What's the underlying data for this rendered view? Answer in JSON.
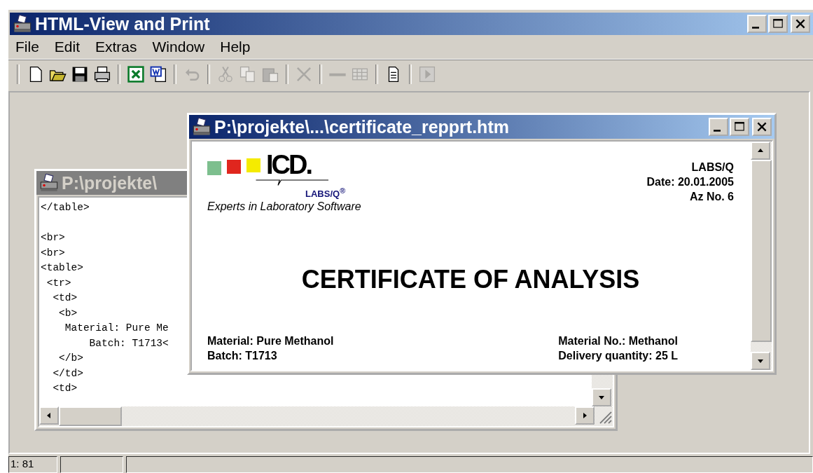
{
  "window": {
    "title": "HTML-View and Print"
  },
  "menu": [
    {
      "label": "File"
    },
    {
      "label": "Edit"
    },
    {
      "label": "Extras"
    },
    {
      "label": "Window"
    },
    {
      "label": "Help"
    }
  ],
  "toolbar": [
    [
      {
        "kind": "new",
        "disabled": false
      },
      {
        "kind": "open",
        "disabled": false
      },
      {
        "kind": "save",
        "disabled": false
      },
      {
        "kind": "print",
        "disabled": false
      }
    ],
    [
      {
        "kind": "excel",
        "disabled": false
      },
      {
        "kind": "word",
        "disabled": false
      }
    ],
    [
      {
        "kind": "undo",
        "disabled": true
      }
    ],
    [
      {
        "kind": "cut",
        "disabled": true
      },
      {
        "kind": "copy",
        "disabled": true
      },
      {
        "kind": "paste",
        "disabled": true
      }
    ],
    [
      {
        "kind": "delete",
        "disabled": true
      }
    ],
    [
      {
        "kind": "line",
        "disabled": true
      },
      {
        "kind": "table",
        "disabled": true
      }
    ],
    [
      {
        "kind": "document",
        "disabled": false
      }
    ],
    [
      {
        "kind": "step",
        "disabled": true
      }
    ]
  ],
  "documents": [
    {
      "kind": "source",
      "title": "P:\\projekte\\",
      "active": false,
      "code": "</table>\n\n<br>\n<br>\n<table>\n <tr>\n  <td>\n   <b>\n    Material: Pure Me\n        Batch: T1713<\n   </b>\n  </td>\n  <td>"
    },
    {
      "kind": "preview",
      "title": "P:\\projekte\\...\\certificate_repprt.htm",
      "active": true,
      "logo_text": "ICD.",
      "logo_subtext": "LABS/Q$^{®}$",
      "tagline": "Experts in Laboratory Software",
      "header_lines": [
        "LABS/Q",
        "Date: 20.01.2005",
        "Az No. 6"
      ],
      "heading": "CERTIFICATE OF ANALYSIS",
      "fields_left": [
        "Material: Pure Methanol",
        "Batch: T1713"
      ],
      "fields_right": [
        "Material No.: Methanol",
        "Delivery quantity: 25 L"
      ]
    }
  ],
  "status_bar": {
    "position": "1: 81"
  }
}
